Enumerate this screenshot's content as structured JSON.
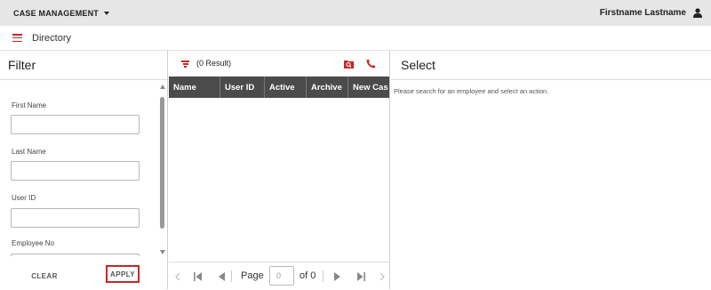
{
  "topbar": {
    "app_menu_label": "CASE MANAGEMENT",
    "user_name": "Firstname Lastname"
  },
  "subbar": {
    "title": "Directory"
  },
  "filter": {
    "title": "Filter",
    "fields": [
      {
        "label": "First Name",
        "value": ""
      },
      {
        "label": "Last Name",
        "value": ""
      },
      {
        "label": "User ID",
        "value": ""
      },
      {
        "label": "Employee No",
        "value": ""
      }
    ],
    "clear_label": "CLEAR",
    "apply_label": "APPLY"
  },
  "results": {
    "count_text": "(0 Result)",
    "columns": [
      "Name",
      "User ID",
      "Active",
      "Archive",
      "New Cas"
    ],
    "rows": [],
    "pager": {
      "page_label": "Page",
      "page_value": "0",
      "of_label": "of 0"
    }
  },
  "select_panel": {
    "title": "Select",
    "message": "Please search for an employee and select an action."
  },
  "colors": {
    "accent": "#c62828",
    "header_bg": "#e6e6e6",
    "grid_header_bg": "#4b4b4b"
  }
}
